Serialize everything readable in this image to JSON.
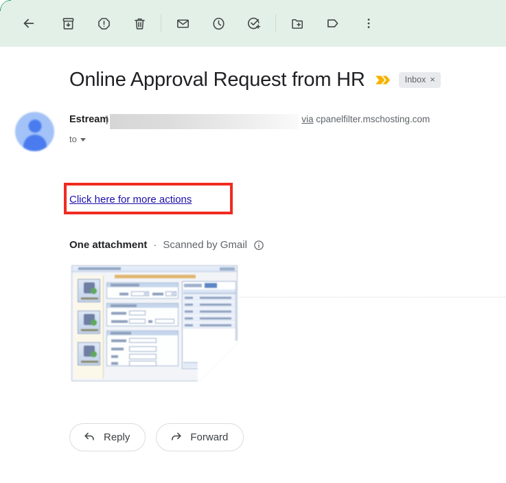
{
  "toolbar": {
    "items": [
      {
        "name": "back-button",
        "icon": "arrow-back-icon",
        "label": "Back to Inbox"
      },
      {
        "name": "archive-button",
        "icon": "archive-icon",
        "label": "Archive"
      },
      {
        "name": "report-spam-button",
        "icon": "report-spam-icon",
        "label": "Report spam"
      },
      {
        "name": "delete-button",
        "icon": "trash-icon",
        "label": "Delete"
      },
      {
        "name": "mark-unread-button",
        "icon": "envelope-icon",
        "label": "Mark as unread"
      },
      {
        "name": "snooze-button",
        "icon": "clock-icon",
        "label": "Snooze"
      },
      {
        "name": "add-to-tasks-button",
        "icon": "task-add-icon",
        "label": "Add to Tasks"
      },
      {
        "name": "move-to-button",
        "icon": "folder-move-icon",
        "label": "Move to"
      },
      {
        "name": "labels-button",
        "icon": "label-tag-icon",
        "label": "Labels"
      },
      {
        "name": "more-button",
        "icon": "more-vert-icon",
        "label": "More"
      }
    ]
  },
  "subject": {
    "text": "Online Approval Request from HR",
    "importance_marker": "importance-marker-icon",
    "label_chip": "Inbox",
    "label_chip_remove": "×"
  },
  "sender": {
    "avatar": "default-user-avatar",
    "name": "Estream",
    "email_redacted": "",
    "via_label": "via",
    "via_domain": "cpanelfilter.mschosting.com",
    "to_label": "to"
  },
  "message_body": {
    "link_text": "Click here for more actions",
    "annotation_color": "#f02b21",
    "link_color": "#1a0dab"
  },
  "attachments": {
    "count_label": "One attachment",
    "separator": "·",
    "scan_label": "Scanned by Gmail",
    "info_icon": "info-circle-icon",
    "thumbnail_alt": "Windows application form screenshot attachment"
  },
  "actions": [
    {
      "name": "reply-button",
      "icon": "reply-arrow-icon",
      "label": "Reply"
    },
    {
      "name": "forward-button",
      "icon": "forward-arrow-icon",
      "label": "Forward"
    }
  ],
  "colors": {
    "toolbar_bg": "#e3f0e8",
    "accent_green": "#0f9d58",
    "link_blue": "#1a0dab",
    "annotation_red": "#f02b21",
    "importance_yellow": "#f4b400",
    "chip_bg": "#e8eaed",
    "text_primary": "#202124",
    "text_secondary": "#5f6368",
    "avatar_bg": "#a3c2f7",
    "avatar_fg": "#4a7cf0"
  }
}
